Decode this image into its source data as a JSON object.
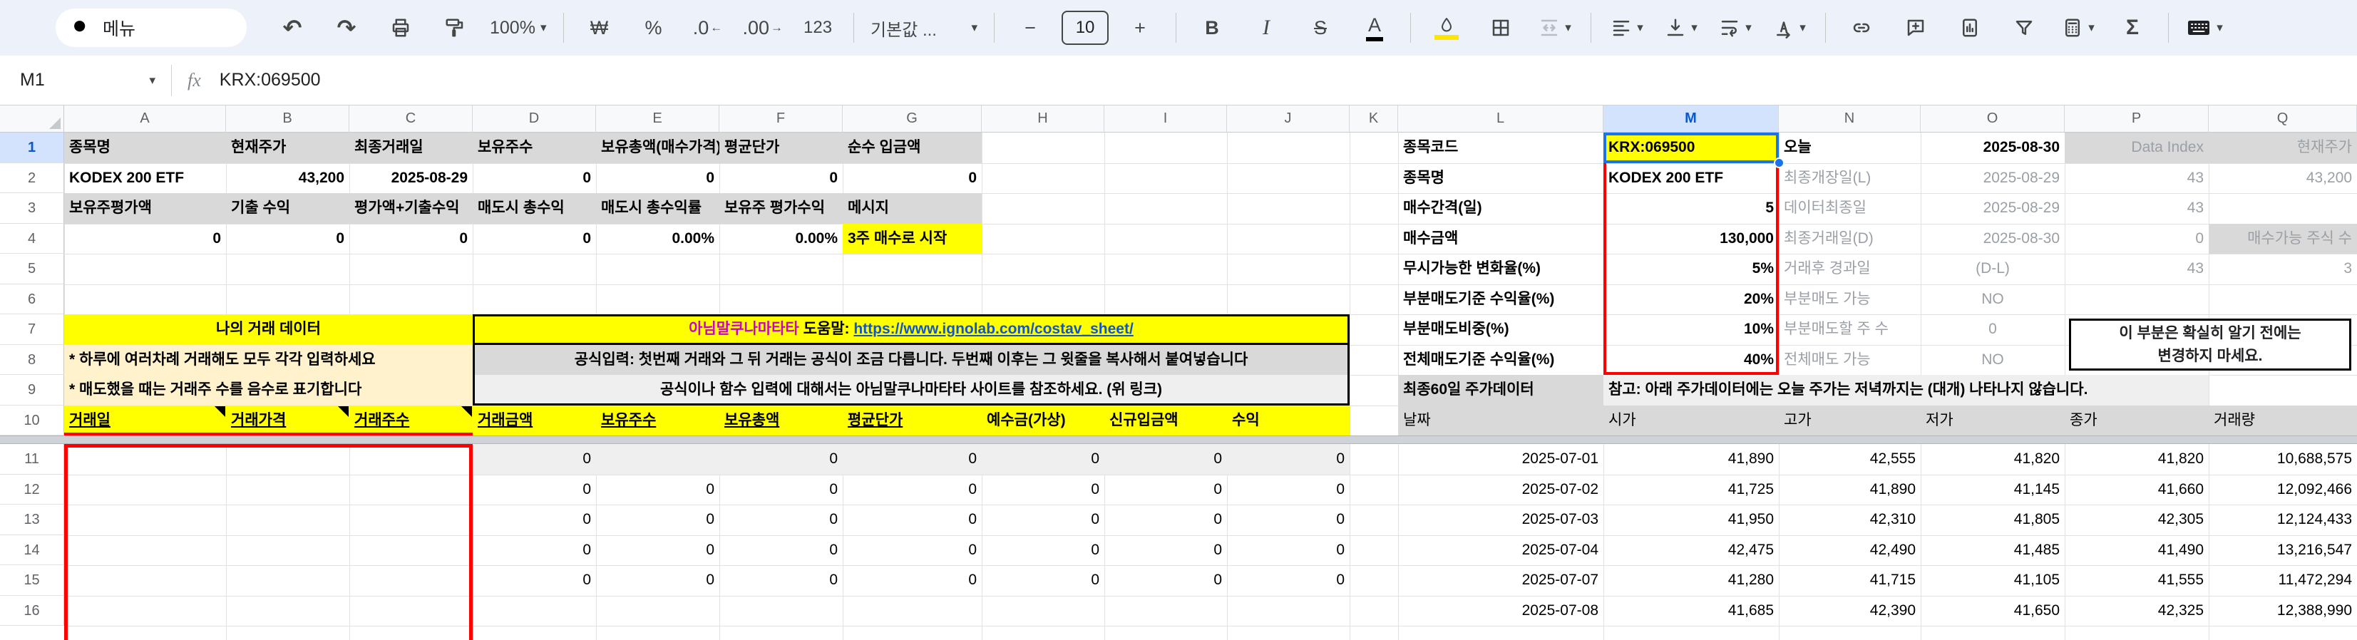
{
  "toolbar": {
    "menu_search": "메뉴",
    "zoom": "100%",
    "currency": "₩",
    "percent": "%",
    "dec_dec": ".0",
    "dec_inc": ".00",
    "num_fmt": "123",
    "font_name": "기본값 ...",
    "font_size": "10",
    "bold": "B",
    "italic": "I",
    "strike": "S",
    "text_color": "A",
    "sum": "Σ"
  },
  "icons": {
    "caret": "▾",
    "undo": "↶",
    "redo": "↷",
    "minus": "−",
    "plus": "+",
    "arrow_left": "←",
    "arrow_right": "→"
  },
  "formula_bar": {
    "cell_ref": "M1",
    "fx": "fx",
    "value": "KRX:069500"
  },
  "sheet": {
    "col_letters": [
      "A",
      "B",
      "C",
      "D",
      "E",
      "F",
      "G",
      "H",
      "I",
      "J",
      "K",
      "L",
      "M",
      "N",
      "O",
      "P",
      "Q"
    ],
    "selected_col": "M",
    "row_numbers": [
      "1",
      "2",
      "3",
      "4",
      "5",
      "6",
      "7",
      "8",
      "9",
      "10",
      "11",
      "12",
      "13",
      "14",
      "15",
      "16"
    ],
    "selected_row": "1",
    "left": {
      "r1": [
        "종목명",
        "현재주가",
        "최종거래일",
        "보유주수",
        "보유총액(매수가격)",
        "평균단가",
        "순수 입금액"
      ],
      "r2": [
        "KODEX 200 ETF",
        "43,200",
        "2025-08-29",
        "0",
        "0",
        "0",
        "0"
      ],
      "r3": [
        "보유주평가액",
        "기출 수익",
        "평가액+기출수익",
        "매도시 총수익",
        "매도시 총수익률",
        "보유주 평가수익",
        "메시지"
      ],
      "r4": [
        "0",
        "0",
        "0",
        "0",
        "0.00%",
        "0.00%"
      ],
      "r4_message": "3주 매수로 시작",
      "r7_title": "나의 거래 데이터",
      "r7_brand": "아님말쿠나마타타",
      "r7_help": " 도움말: ",
      "r7_link": "https://www.ignolab.com/costav_sheet/",
      "r8_left": "* 하루에 여러차례 거래해도 모두 각각 입력하세요",
      "r8_right": "공식입력: 첫번째 거래와 그 뒤 거래는 공식이 조금 다릅니다. 두번째 이후는 그 윗줄을 복사해서 붙여넣습니다",
      "r9_left": "* 매도했을 때는 거래주 수를 음수로 표기합니다",
      "r9_right": "공식이나 함수 입력에 대해서는 아님말쿠나마타타 사이트를 참조하세요. (위 링크)",
      "r10_headers": [
        "거래일",
        "거래가격",
        "거래주수",
        "거래금액",
        "보유주수",
        "보유총액",
        "평균단가",
        "예수금(가상)",
        "신규입금액",
        "수익"
      ],
      "zero_rows": [
        [
          "0",
          "",
          "0",
          "0",
          "0",
          "0",
          "0"
        ],
        [
          "0",
          "0",
          "0",
          "0",
          "0",
          "0",
          "0"
        ],
        [
          "0",
          "0",
          "0",
          "0",
          "0",
          "0",
          "0"
        ],
        [
          "0",
          "0",
          "0",
          "0",
          "0",
          "0",
          "0"
        ],
        [
          "0",
          "0",
          "0",
          "0",
          "0",
          "0",
          "0"
        ],
        [
          "",
          "",
          "",
          "",
          "",
          "",
          ""
        ]
      ]
    },
    "panel": {
      "rows": [
        {
          "label": "종목코드",
          "value": "KRX:069500",
          "n": "오늘",
          "o": "2025-08-30",
          "p": "Data Index",
          "q": "현재주가"
        },
        {
          "label": "종목명",
          "value": "KODEX 200 ETF",
          "n": "최종개장일(L)",
          "o": "2025-08-29",
          "p": "43",
          "q": "43,200"
        },
        {
          "label": "매수간격(일)",
          "value": "5",
          "n": "데이터최종일",
          "o": "2025-08-29",
          "p": "43",
          "q": ""
        },
        {
          "label": "매수금액",
          "value": "130,000",
          "n": "최종거래일(D)",
          "o": "2025-08-30",
          "p": "0",
          "q": "매수가능 주식 수"
        },
        {
          "label": "무시가능한 변화율(%)",
          "value": "5%",
          "n": "거래후 경과일",
          "o": "(D-L)",
          "p": "43",
          "q": "3"
        },
        {
          "label": "부분매도기준 수익율(%)",
          "value": "20%",
          "n": "부분매도 가능",
          "o": "NO",
          "p": "",
          "q": ""
        },
        {
          "label": "부분매도비중(%)",
          "value": "10%",
          "n": "부분매도할 주 수",
          "o": "0",
          "p": "",
          "q": ""
        },
        {
          "label": "전체매도기준 수익율(%)",
          "value": "40%",
          "n": "전체매도 가능",
          "o": "NO",
          "p": "",
          "q": ""
        }
      ],
      "l9_label": "최종60일 주가데이터",
      "m9_note": "참고: 아래 주가데이터에는 오늘 주가는 저녁까지는 (대개) 나타나지 않습니다.",
      "warning_line1": "이 부분은 확실히 알기 전에는",
      "warning_line2": "변경하지 마세요."
    },
    "price_table": {
      "headers": [
        "날짜",
        "시가",
        "고가",
        "저가",
        "종가",
        "거래량"
      ],
      "rows": [
        [
          "2025-07-01",
          "41,890",
          "42,555",
          "41,820",
          "41,820",
          "10,688,575"
        ],
        [
          "2025-07-02",
          "41,725",
          "41,890",
          "41,145",
          "41,660",
          "12,092,466"
        ],
        [
          "2025-07-03",
          "41,950",
          "42,310",
          "41,805",
          "42,305",
          "12,124,433"
        ],
        [
          "2025-07-04",
          "42,475",
          "42,490",
          "41,485",
          "41,490",
          "13,216,547"
        ],
        [
          "2025-07-07",
          "41,280",
          "41,715",
          "41,105",
          "41,555",
          "11,472,294"
        ],
        [
          "2025-07-08",
          "41,685",
          "42,390",
          "41,650",
          "42,325",
          "12,388,990"
        ]
      ]
    }
  },
  "colors": {
    "accent": "#1a73e8",
    "selection_header": "#d3e3fd",
    "yellow": "#ffff00",
    "red": "#ff0000",
    "brand_magenta": "#cc00cc",
    "link_blue": "#1155cc",
    "gray_cell": "#d9d9d9",
    "light_gray": "#efefef",
    "cream": "#fff2cc",
    "gray_text": "#9aa0a6"
  }
}
